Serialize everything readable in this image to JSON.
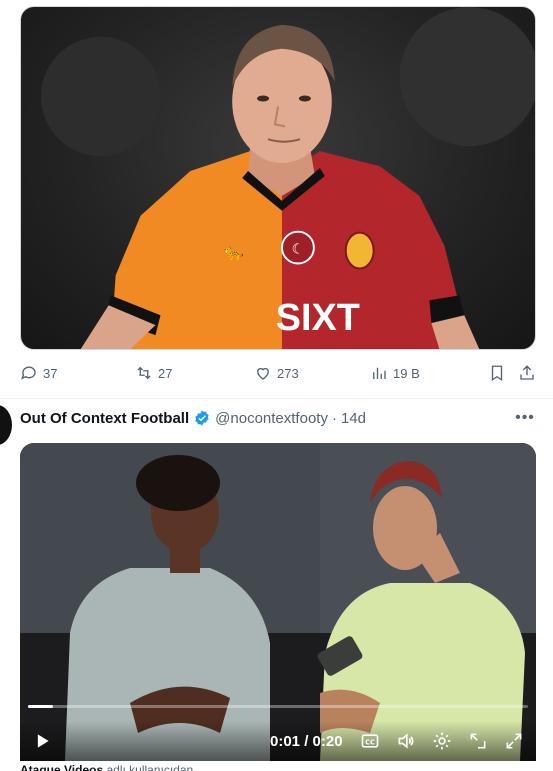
{
  "post1": {
    "image_alt": "Football player in orange and red Galatasaray kit",
    "shirt_sponsor": "SIXT",
    "shirt_maker": "PUMA",
    "actions": {
      "replies": "37",
      "reposts": "27",
      "likes": "273",
      "views": "19 B"
    }
  },
  "post2": {
    "display_name": "Out Of Context Football",
    "handle": "@nocontextfooty",
    "separator": "·",
    "time": "14d",
    "more_label": "•••",
    "video": {
      "current_time": "0:01",
      "duration": "0:20",
      "time_separator": " / ",
      "progress": 0.05
    },
    "below_caption_bold": "Ataque Videos",
    "below_caption": " adlı kullanıcıdan"
  },
  "icons": {
    "reply": "reply-icon",
    "retweet": "retweet-icon",
    "like": "heart-icon",
    "views": "views-icon",
    "bookmark": "bookmark-icon",
    "share": "share-icon",
    "verified": "verified-badge-icon",
    "play": "play-icon",
    "cc": "captions-icon",
    "volume": "volume-icon",
    "settings": "gear-icon",
    "pip": "picture-in-picture-icon",
    "fullscreen": "fullscreen-icon"
  },
  "colors": {
    "accent": "#1d9bf0",
    "muted": "#536471",
    "text": "#0f1419"
  }
}
